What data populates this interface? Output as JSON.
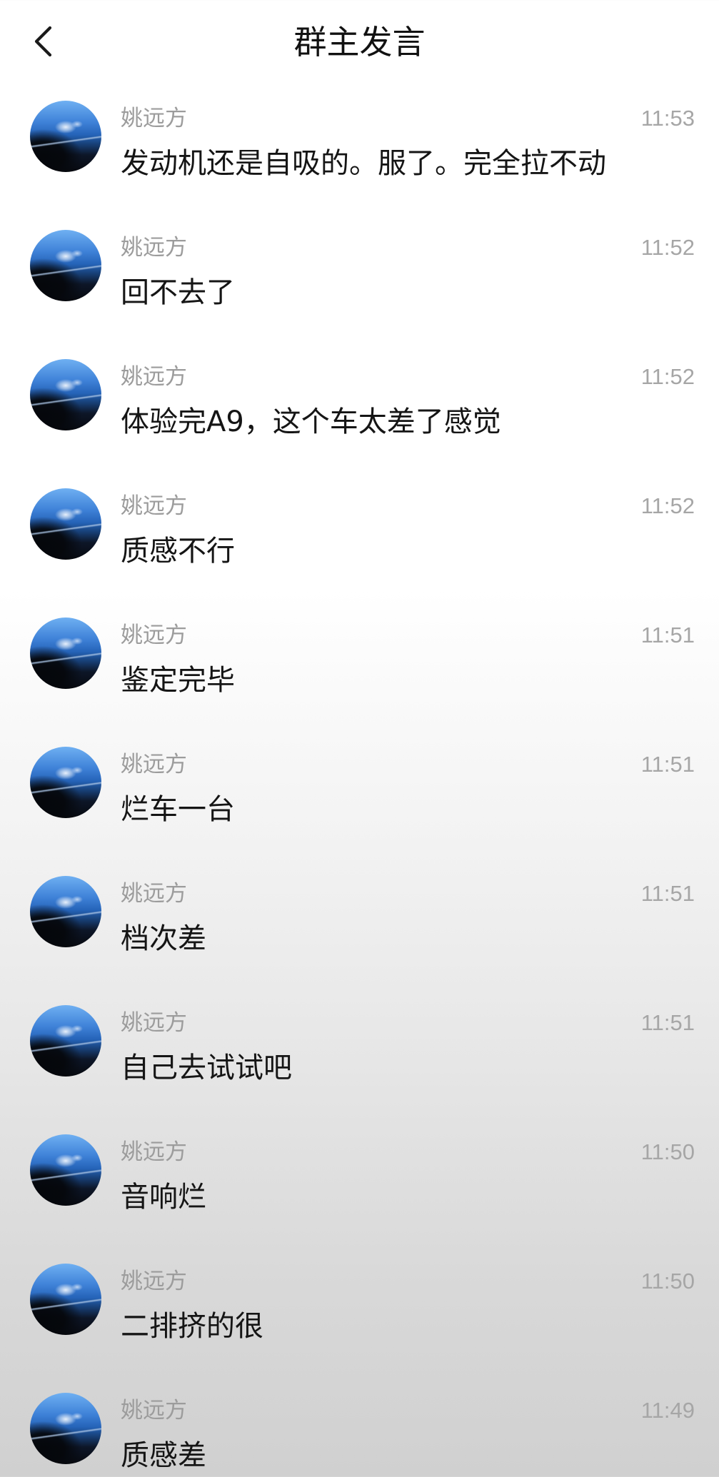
{
  "header": {
    "title": "群主发言",
    "back_icon": "chevron-left-icon"
  },
  "messages": [
    {
      "name": "姚远方",
      "time": "11:53",
      "text": "发动机还是自吸的。服了。完全拉不动"
    },
    {
      "name": "姚远方",
      "time": "11:52",
      "text": "回不去了"
    },
    {
      "name": "姚远方",
      "time": "11:52",
      "text": "体验完A9，这个车太差了感觉"
    },
    {
      "name": "姚远方",
      "time": "11:52",
      "text": "质感不行"
    },
    {
      "name": "姚远方",
      "time": "11:51",
      "text": "鉴定完毕"
    },
    {
      "name": "姚远方",
      "time": "11:51",
      "text": "烂车一台"
    },
    {
      "name": "姚远方",
      "time": "11:51",
      "text": "档次差"
    },
    {
      "name": "姚远方",
      "time": "11:51",
      "text": "自己去试试吧"
    },
    {
      "name": "姚远方",
      "time": "11:50",
      "text": "音响烂"
    },
    {
      "name": "姚远方",
      "time": "11:50",
      "text": "二排挤的很"
    },
    {
      "name": "姚远方",
      "time": "11:49",
      "text": "质感差"
    }
  ],
  "colors": {
    "background_top": "#ffffff",
    "background_bottom": "#d0d0d0",
    "title": "#111111",
    "name": "#9c9c9c",
    "time": "#a6a6a6",
    "message_text": "#151515",
    "avatar_sky": "#3f82d8"
  }
}
